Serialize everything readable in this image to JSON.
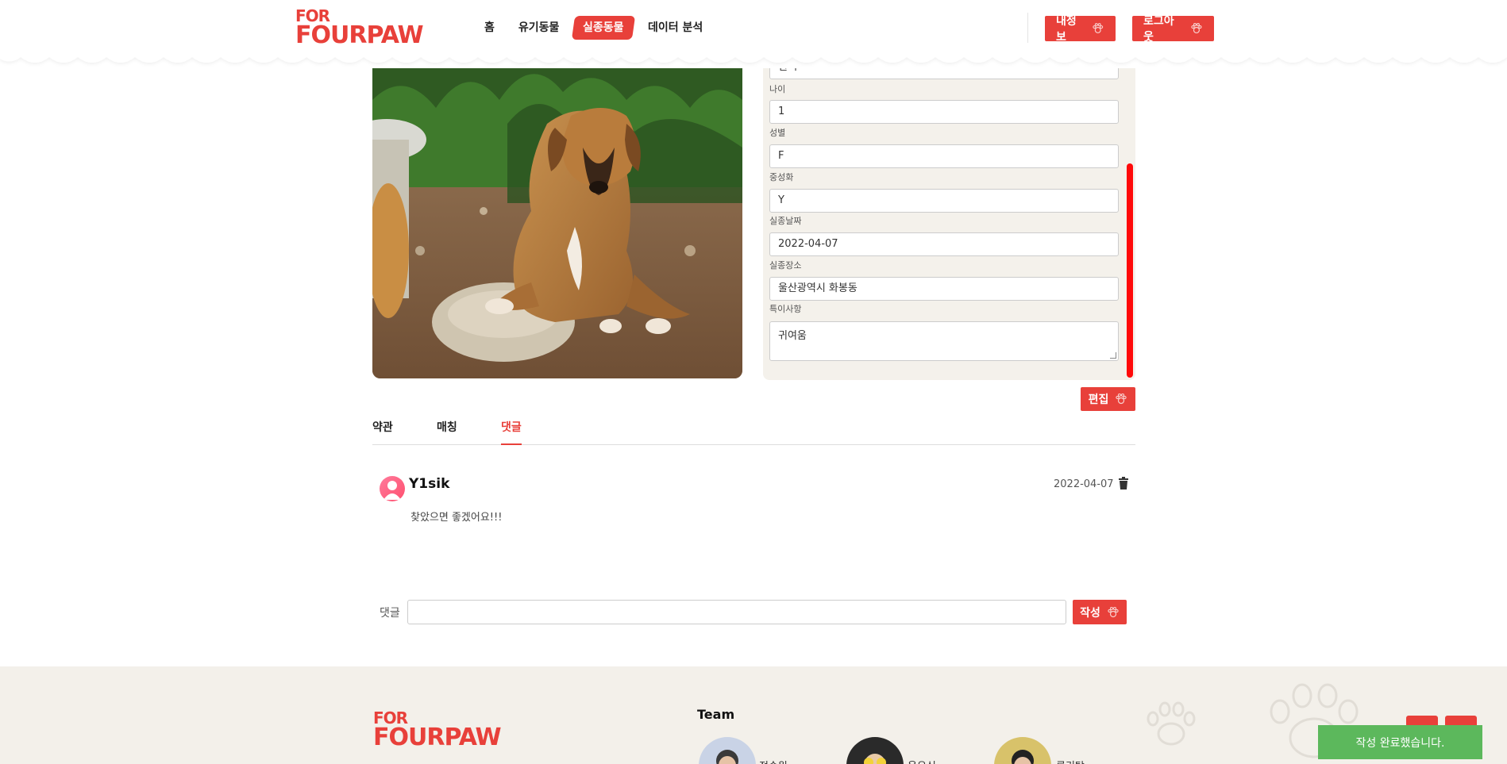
{
  "header": {
    "logo_line1": "FOR",
    "logo_line2": "FOURPAW",
    "nav": [
      "홈",
      "유기동물",
      "실종동물",
      "데이터 분석"
    ],
    "active_nav": "실종동물",
    "my_info_label": "내정보",
    "logout_label": "로그아웃"
  },
  "form": {
    "color_value": "흰색",
    "age_label": "나이",
    "age_value": "1",
    "sex_label": "성별",
    "sex_value": "F",
    "neutered_label": "중성화",
    "neutered_value": "Y",
    "missing_date_label": "실종날짜",
    "missing_date_value": "2022-04-07",
    "missing_place_label": "실종장소",
    "missing_place_value": "울산광역시 화봉동",
    "notes_label": "특이사항",
    "notes_value": "귀여움",
    "edit_label": "편집"
  },
  "tabs": [
    "약관",
    "매칭",
    "댓글"
  ],
  "active_tab": "댓글",
  "comment": {
    "user": "Y1sik",
    "date": "2022-04-07",
    "text": "찾았으면 좋겠어요!!!"
  },
  "comment_form": {
    "label": "댓글",
    "submit_label": "작성"
  },
  "footer": {
    "logo_line1": "FOR",
    "logo_line2": "FOURPAW",
    "team_title": "Team",
    "members": [
      "정승원",
      "윤유식",
      "류기탁"
    ]
  },
  "toast": "작성 완료했습니다.",
  "colors": {
    "brand": "#e8403a",
    "panel": "#f4f1eb",
    "footer": "#f3f0ea",
    "toast": "#5cb85c"
  }
}
